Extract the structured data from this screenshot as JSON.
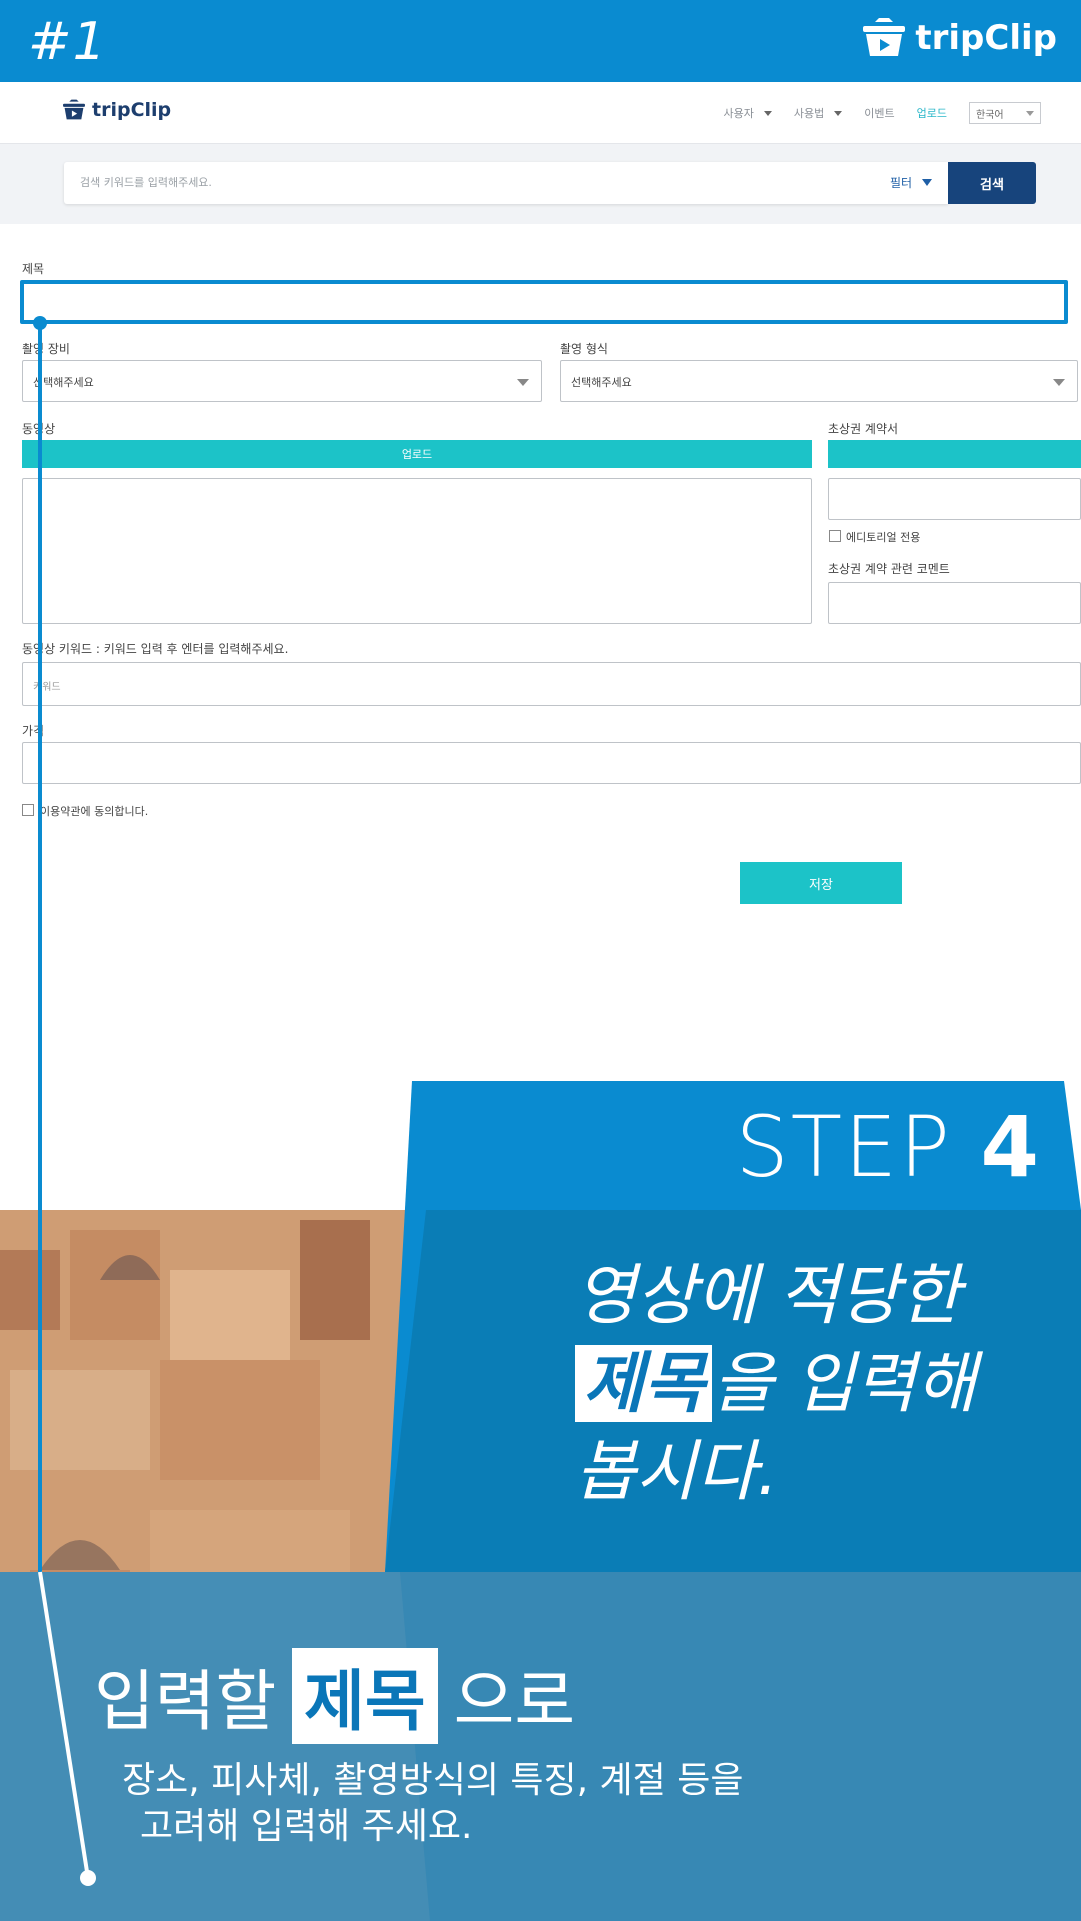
{
  "banner": {
    "step_number": "#1",
    "brand": "tripClip"
  },
  "header": {
    "brand": "tripClip",
    "nav": [
      "사용자",
      "사용법",
      "이벤트",
      "업로드"
    ],
    "language": "한국어"
  },
  "search": {
    "placeholder": "검색 키워드를 입력해주세요.",
    "filter_label": "필터",
    "button_label": "검색"
  },
  "form": {
    "title_label": "제목",
    "equipment_label": "촬영 장비",
    "equipment_value": "선택해주세요",
    "format_label": "촬영 형식",
    "format_value": "선택해주세요",
    "video_label": "동영상",
    "upload_label": "업로드",
    "portrait_label": "초상권 계약서",
    "editorial_label": "에디토리얼 전용",
    "portrait_comment_label": "초상권 계약 관련 코멘트",
    "keyword_label": "동영상 키워드 : 키워드 입력 후 엔터를 입력해주세요.",
    "keyword_placeholder": "키워드",
    "price_label": "가격",
    "terms_label": "이용약관에 동의합니다.",
    "save_label": "저장"
  },
  "overlay": {
    "step_word": "STEP",
    "step_number": "4",
    "headline_line1": "영상에 적당한",
    "headline_highlight": "제목",
    "headline_line2_rest": "을 입력해",
    "headline_line3": "봅시다.",
    "sub_prefix": "입력할",
    "sub_highlight": "제목",
    "sub_suffix": "으로",
    "body_line1": "장소, 피사체, 촬영방식의 특징, 계절 등을",
    "body_line2": "고려해 입력해 주세요."
  },
  "colors": {
    "brand_blue": "#0a8bd0",
    "dark_navy": "#17447c",
    "teal": "#1cc3c8"
  }
}
